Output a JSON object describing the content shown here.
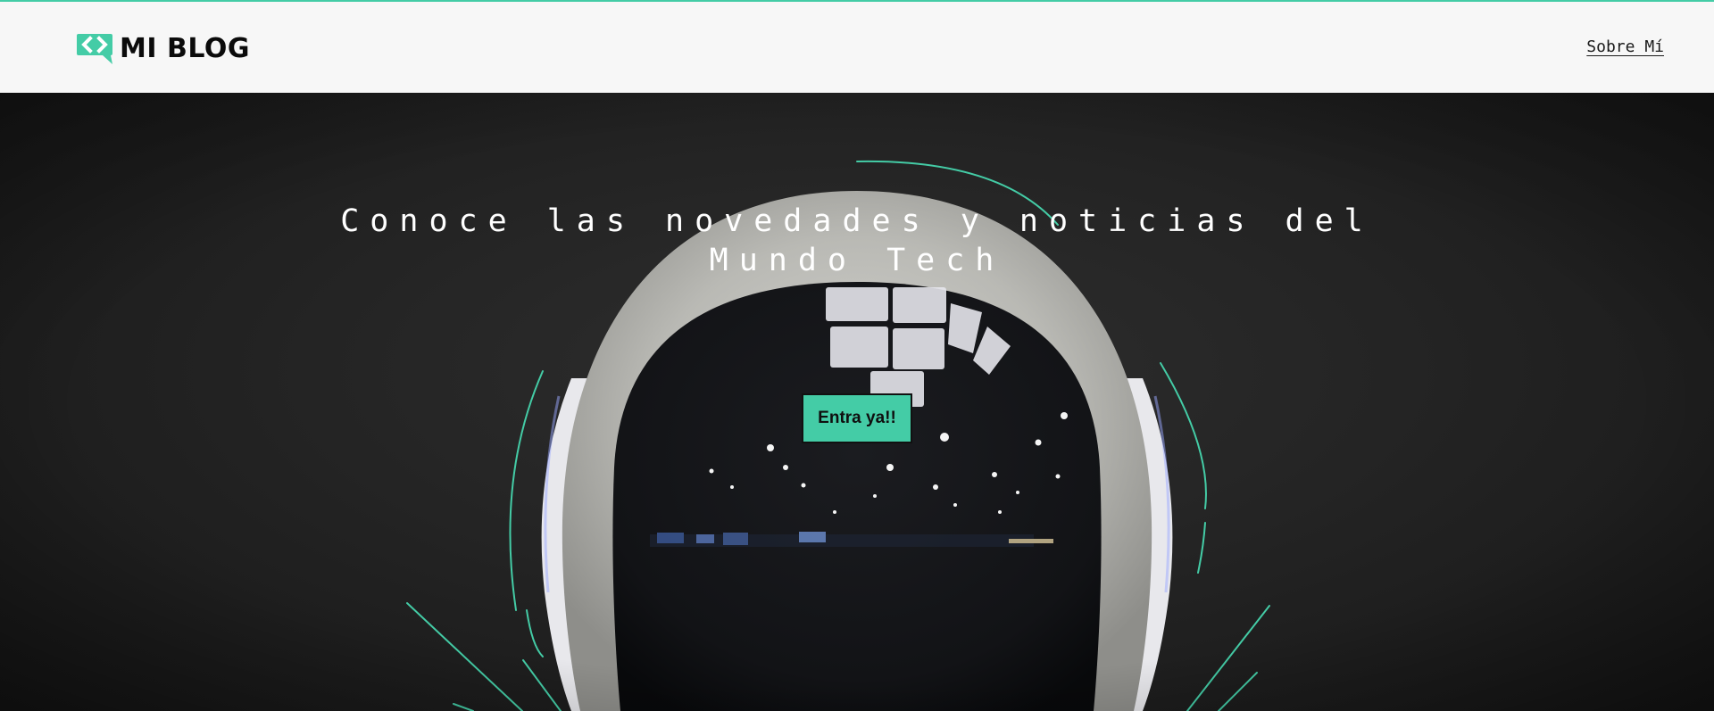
{
  "brand": {
    "name": "MI BLOG",
    "icon": "code-chat-bubble-icon",
    "accent_color": "#44cca6"
  },
  "nav": {
    "about_label": "Sobre Mí"
  },
  "hero": {
    "title": "Conoce las novedades y noticias del Mundo Tech",
    "cta_label": "Entra ya!!",
    "background": "astronaut-helmet-photo"
  }
}
